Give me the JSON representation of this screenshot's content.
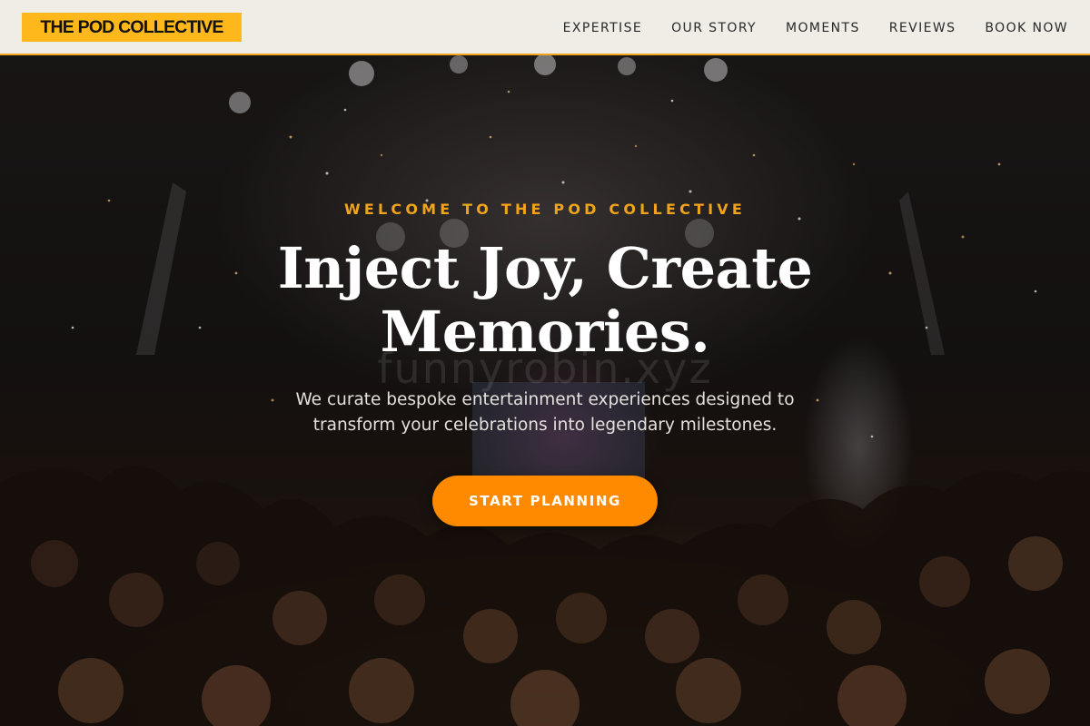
{
  "brand": {
    "logo_text": "THE POD COLLECTIVE",
    "logo_bg": "#ffb81c",
    "accent": "#ff8a00",
    "eyebrow_color": "#f0a41c"
  },
  "nav": {
    "items": [
      {
        "label": "EXPERTISE"
      },
      {
        "label": "OUR STORY"
      },
      {
        "label": "MOMENTS"
      },
      {
        "label": "REVIEWS"
      },
      {
        "label": "BOOK NOW"
      }
    ]
  },
  "hero": {
    "eyebrow": "WELCOME TO THE POD COLLECTIVE",
    "headline": "Inject Joy, Create Memories.",
    "subtext": "We curate bespoke entertainment experiences designed to transform your celebrations into legendary milestones.",
    "cta_label": "START PLANNING",
    "watermark": "funnyrobin.xyz",
    "background_image": "concert-crowd-confetti"
  }
}
